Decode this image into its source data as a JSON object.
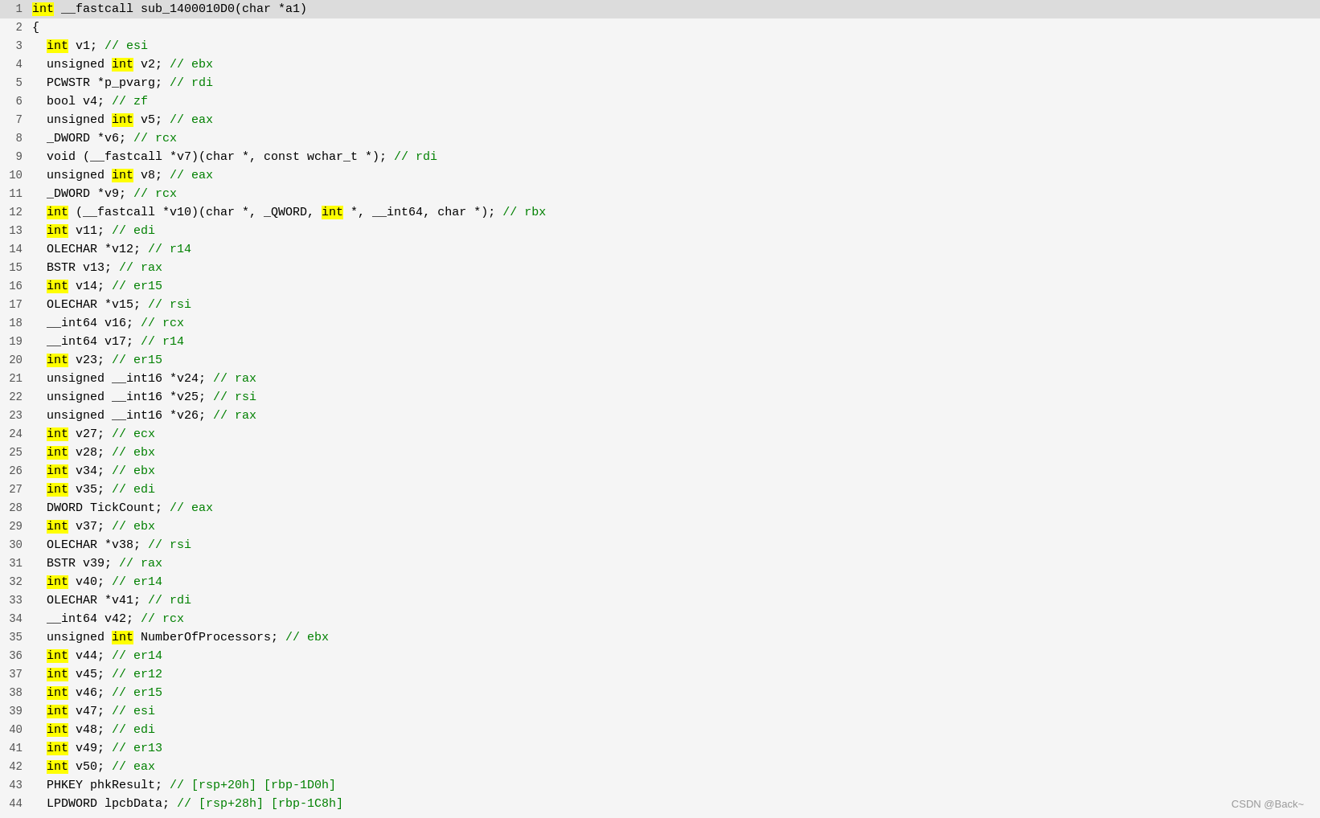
{
  "watermark": "CSDN @Back~",
  "lines": [
    {
      "num": 1,
      "parts": [
        {
          "text": "int",
          "style": "kw-yellow"
        },
        {
          "text": " __fastcall sub_1400010D0(char *a1)",
          "style": "plain"
        }
      ],
      "highlight": true
    },
    {
      "num": 2,
      "parts": [
        {
          "text": "{",
          "style": "plain"
        }
      ]
    },
    {
      "num": 3,
      "parts": [
        {
          "text": "  ",
          "style": "plain"
        },
        {
          "text": "int",
          "style": "kw-yellow"
        },
        {
          "text": " v1; ",
          "style": "plain"
        },
        {
          "text": "// esi",
          "style": "comment"
        }
      ]
    },
    {
      "num": 4,
      "parts": [
        {
          "text": "  unsigned ",
          "style": "plain"
        },
        {
          "text": "int",
          "style": "kw-yellow"
        },
        {
          "text": " v2; ",
          "style": "plain"
        },
        {
          "text": "// ebx",
          "style": "comment"
        }
      ]
    },
    {
      "num": 5,
      "parts": [
        {
          "text": "  PCWSTR *p_pvarg; ",
          "style": "plain"
        },
        {
          "text": "// rdi",
          "style": "comment"
        }
      ]
    },
    {
      "num": 6,
      "parts": [
        {
          "text": "  bool v4; ",
          "style": "plain"
        },
        {
          "text": "// zf",
          "style": "comment"
        }
      ]
    },
    {
      "num": 7,
      "parts": [
        {
          "text": "  unsigned ",
          "style": "plain"
        },
        {
          "text": "int",
          "style": "kw-yellow"
        },
        {
          "text": " v5; ",
          "style": "plain"
        },
        {
          "text": "// eax",
          "style": "comment"
        }
      ]
    },
    {
      "num": 8,
      "parts": [
        {
          "text": "  _DWORD *v6; ",
          "style": "plain"
        },
        {
          "text": "// rcx",
          "style": "comment"
        }
      ]
    },
    {
      "num": 9,
      "parts": [
        {
          "text": "  void (__fastcall *v7)(char *, const wchar_t *); ",
          "style": "plain"
        },
        {
          "text": "// rdi",
          "style": "comment"
        }
      ]
    },
    {
      "num": 10,
      "parts": [
        {
          "text": "  unsigned ",
          "style": "plain"
        },
        {
          "text": "int",
          "style": "kw-yellow"
        },
        {
          "text": " v8; ",
          "style": "plain"
        },
        {
          "text": "// eax",
          "style": "comment"
        }
      ]
    },
    {
      "num": 11,
      "parts": [
        {
          "text": "  _DWORD *v9; ",
          "style": "plain"
        },
        {
          "text": "// rcx",
          "style": "comment"
        }
      ]
    },
    {
      "num": 12,
      "parts": [
        {
          "text": "  ",
          "style": "plain"
        },
        {
          "text": "int",
          "style": "kw-yellow"
        },
        {
          "text": " (__fastcall *v10)(char *, _QWORD, ",
          "style": "plain"
        },
        {
          "text": "int",
          "style": "kw-yellow"
        },
        {
          "text": " *, __int64, char *); ",
          "style": "plain"
        },
        {
          "text": "// rbx",
          "style": "comment"
        }
      ]
    },
    {
      "num": 13,
      "parts": [
        {
          "text": "  ",
          "style": "plain"
        },
        {
          "text": "int",
          "style": "kw-yellow"
        },
        {
          "text": " v11; ",
          "style": "plain"
        },
        {
          "text": "// edi",
          "style": "comment"
        }
      ]
    },
    {
      "num": 14,
      "parts": [
        {
          "text": "  OLECHAR *v12; ",
          "style": "plain"
        },
        {
          "text": "// r14",
          "style": "comment"
        }
      ]
    },
    {
      "num": 15,
      "parts": [
        {
          "text": "  BSTR v13; ",
          "style": "plain"
        },
        {
          "text": "// rax",
          "style": "comment"
        }
      ]
    },
    {
      "num": 16,
      "parts": [
        {
          "text": "  ",
          "style": "plain"
        },
        {
          "text": "int",
          "style": "kw-yellow"
        },
        {
          "text": " v14; ",
          "style": "plain"
        },
        {
          "text": "// er15",
          "style": "comment"
        }
      ]
    },
    {
      "num": 17,
      "parts": [
        {
          "text": "  OLECHAR *v15; ",
          "style": "plain"
        },
        {
          "text": "// rsi",
          "style": "comment"
        }
      ]
    },
    {
      "num": 18,
      "parts": [
        {
          "text": "  __int64 v16; ",
          "style": "plain"
        },
        {
          "text": "// rcx",
          "style": "comment"
        }
      ]
    },
    {
      "num": 19,
      "parts": [
        {
          "text": "  __int64 v17; ",
          "style": "plain"
        },
        {
          "text": "// r14",
          "style": "comment"
        }
      ]
    },
    {
      "num": 20,
      "parts": [
        {
          "text": "  ",
          "style": "plain"
        },
        {
          "text": "int",
          "style": "kw-yellow"
        },
        {
          "text": " v23; ",
          "style": "plain"
        },
        {
          "text": "// er15",
          "style": "comment"
        }
      ]
    },
    {
      "num": 21,
      "parts": [
        {
          "text": "  unsigned __int16 *v24; ",
          "style": "plain"
        },
        {
          "text": "// rax",
          "style": "comment"
        }
      ]
    },
    {
      "num": 22,
      "parts": [
        {
          "text": "  unsigned __int16 *v25; ",
          "style": "plain"
        },
        {
          "text": "// rsi",
          "style": "comment"
        }
      ]
    },
    {
      "num": 23,
      "parts": [
        {
          "text": "  unsigned __int16 *v26; ",
          "style": "plain"
        },
        {
          "text": "// rax",
          "style": "comment"
        }
      ]
    },
    {
      "num": 24,
      "parts": [
        {
          "text": "  ",
          "style": "plain"
        },
        {
          "text": "int",
          "style": "kw-yellow"
        },
        {
          "text": " v27; ",
          "style": "plain"
        },
        {
          "text": "// ecx",
          "style": "comment"
        }
      ]
    },
    {
      "num": 25,
      "parts": [
        {
          "text": "  ",
          "style": "plain"
        },
        {
          "text": "int",
          "style": "kw-yellow"
        },
        {
          "text": " v28; ",
          "style": "plain"
        },
        {
          "text": "// ebx",
          "style": "comment"
        }
      ]
    },
    {
      "num": 26,
      "parts": [
        {
          "text": "  ",
          "style": "plain"
        },
        {
          "text": "int",
          "style": "kw-yellow"
        },
        {
          "text": " v34; ",
          "style": "plain"
        },
        {
          "text": "// ebx",
          "style": "comment"
        }
      ]
    },
    {
      "num": 27,
      "parts": [
        {
          "text": "  ",
          "style": "plain"
        },
        {
          "text": "int",
          "style": "kw-yellow"
        },
        {
          "text": " v35; ",
          "style": "plain"
        },
        {
          "text": "// edi",
          "style": "comment"
        }
      ]
    },
    {
      "num": 28,
      "parts": [
        {
          "text": "  DWORD TickCount; ",
          "style": "plain"
        },
        {
          "text": "// eax",
          "style": "comment"
        }
      ]
    },
    {
      "num": 29,
      "parts": [
        {
          "text": "  ",
          "style": "plain"
        },
        {
          "text": "int",
          "style": "kw-yellow"
        },
        {
          "text": " v37; ",
          "style": "plain"
        },
        {
          "text": "// ebx",
          "style": "comment"
        }
      ]
    },
    {
      "num": 30,
      "parts": [
        {
          "text": "  OLECHAR *v38; ",
          "style": "plain"
        },
        {
          "text": "// rsi",
          "style": "comment"
        }
      ]
    },
    {
      "num": 31,
      "parts": [
        {
          "text": "  BSTR v39; ",
          "style": "plain"
        },
        {
          "text": "// rax",
          "style": "comment"
        }
      ]
    },
    {
      "num": 32,
      "parts": [
        {
          "text": "  ",
          "style": "plain"
        },
        {
          "text": "int",
          "style": "kw-yellow"
        },
        {
          "text": " v40; ",
          "style": "plain"
        },
        {
          "text": "// er14",
          "style": "comment"
        }
      ]
    },
    {
      "num": 33,
      "parts": [
        {
          "text": "  OLECHAR *v41; ",
          "style": "plain"
        },
        {
          "text": "// rdi",
          "style": "comment"
        }
      ]
    },
    {
      "num": 34,
      "parts": [
        {
          "text": "  __int64 v42; ",
          "style": "plain"
        },
        {
          "text": "// rcx",
          "style": "comment"
        }
      ]
    },
    {
      "num": 35,
      "parts": [
        {
          "text": "  unsigned ",
          "style": "plain"
        },
        {
          "text": "int",
          "style": "kw-yellow"
        },
        {
          "text": " NumberOfProcessors; ",
          "style": "plain"
        },
        {
          "text": "// ebx",
          "style": "comment"
        }
      ]
    },
    {
      "num": 36,
      "parts": [
        {
          "text": "  ",
          "style": "plain"
        },
        {
          "text": "int",
          "style": "kw-yellow"
        },
        {
          "text": " v44; ",
          "style": "plain"
        },
        {
          "text": "// er14",
          "style": "comment"
        }
      ]
    },
    {
      "num": 37,
      "parts": [
        {
          "text": "  ",
          "style": "plain"
        },
        {
          "text": "int",
          "style": "kw-yellow"
        },
        {
          "text": " v45; ",
          "style": "plain"
        },
        {
          "text": "// er12",
          "style": "comment"
        }
      ]
    },
    {
      "num": 38,
      "parts": [
        {
          "text": "  ",
          "style": "plain"
        },
        {
          "text": "int",
          "style": "kw-yellow"
        },
        {
          "text": " v46; ",
          "style": "plain"
        },
        {
          "text": "// er15",
          "style": "comment"
        }
      ]
    },
    {
      "num": 39,
      "parts": [
        {
          "text": "  ",
          "style": "plain"
        },
        {
          "text": "int",
          "style": "kw-yellow"
        },
        {
          "text": " v47; ",
          "style": "plain"
        },
        {
          "text": "// esi",
          "style": "comment"
        }
      ]
    },
    {
      "num": 40,
      "parts": [
        {
          "text": "  ",
          "style": "plain"
        },
        {
          "text": "int",
          "style": "kw-yellow"
        },
        {
          "text": " v48; ",
          "style": "plain"
        },
        {
          "text": "// edi",
          "style": "comment"
        }
      ]
    },
    {
      "num": 41,
      "parts": [
        {
          "text": "  ",
          "style": "plain"
        },
        {
          "text": "int",
          "style": "kw-yellow"
        },
        {
          "text": " v49; ",
          "style": "plain"
        },
        {
          "text": "// er13",
          "style": "comment"
        }
      ]
    },
    {
      "num": 42,
      "parts": [
        {
          "text": "  ",
          "style": "plain"
        },
        {
          "text": "int",
          "style": "kw-yellow"
        },
        {
          "text": " v50; ",
          "style": "plain"
        },
        {
          "text": "// eax",
          "style": "comment"
        }
      ]
    },
    {
      "num": 43,
      "parts": [
        {
          "text": "  PHKEY phkResult; ",
          "style": "plain"
        },
        {
          "text": "// [rsp+20h] [rbp-1D0h]",
          "style": "comment"
        }
      ]
    },
    {
      "num": 44,
      "parts": [
        {
          "text": "  LPDWORD lpcbData; ",
          "style": "plain"
        },
        {
          "text": "// [rsp+28h] [rbp-1C8h]",
          "style": "comment"
        }
      ]
    }
  ]
}
